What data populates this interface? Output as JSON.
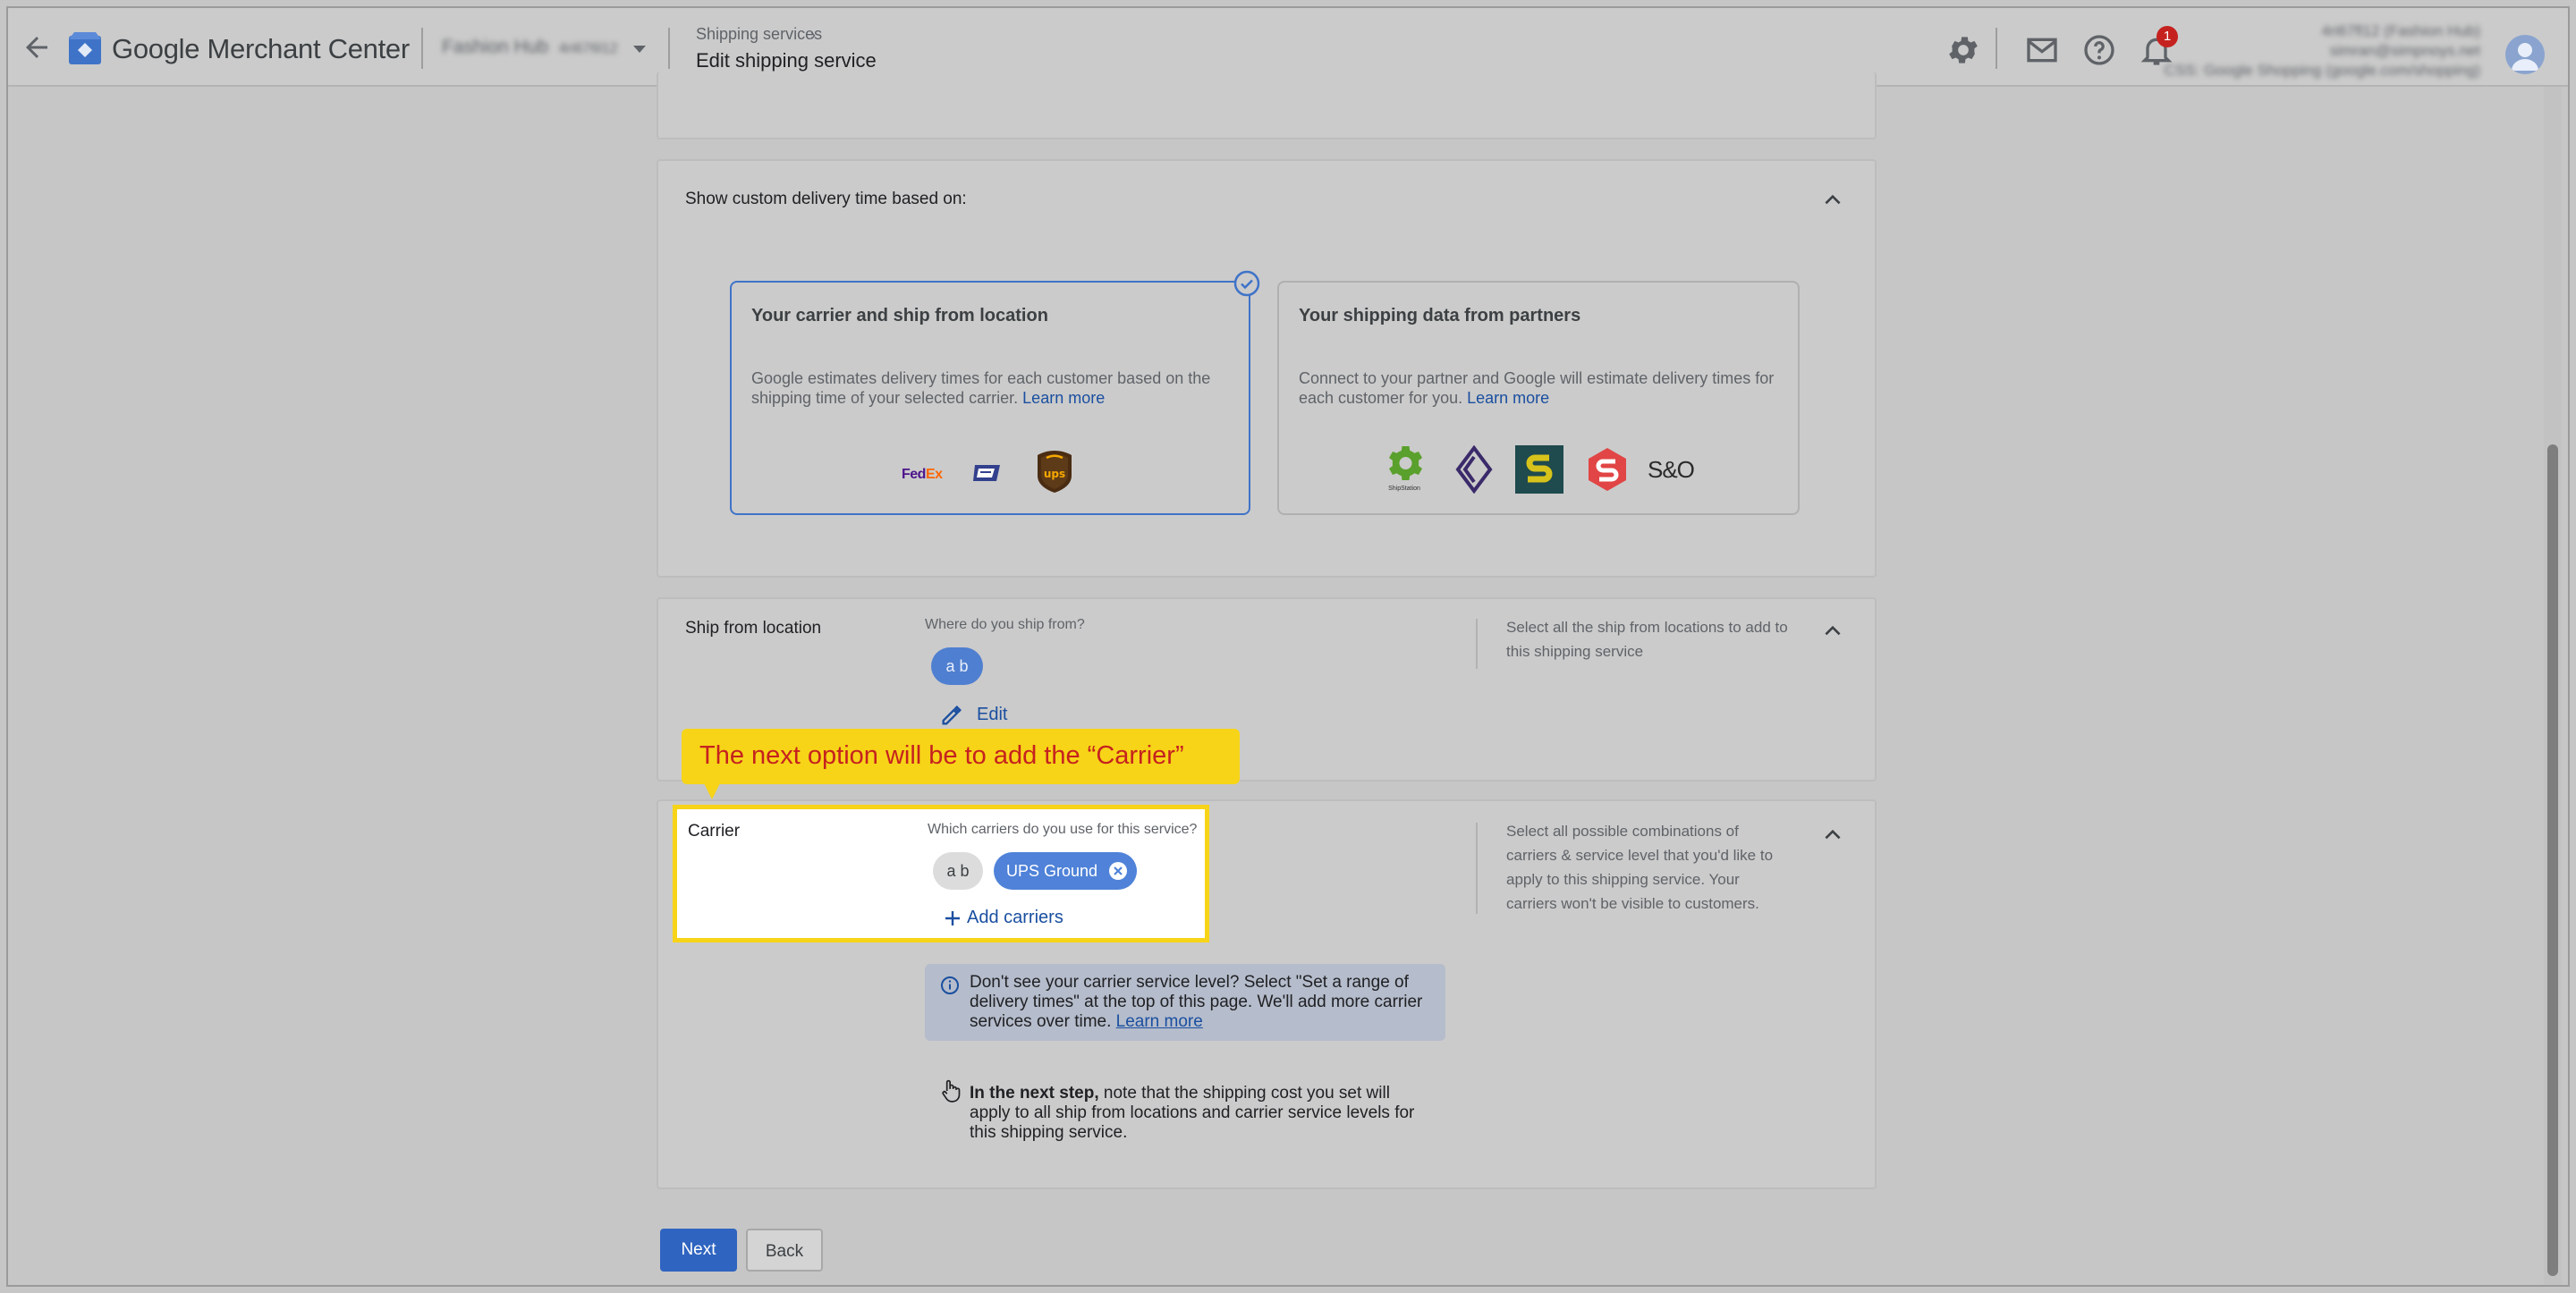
{
  "header": {
    "brand": "Google Merchant Center",
    "account_name": "Fashion Hub",
    "account_id": "4ri676l12",
    "breadcrumb": "Shipping services",
    "page_title": "Edit shipping service",
    "notification_count": "1",
    "user_line1": "4ri67fl12 (Fashion Hub)",
    "user_line2": "simran@simpnoys.net",
    "user_line3": "CSS: Google Shopping (google.com/shopping)"
  },
  "custom_delivery": {
    "title": "Show custom delivery time based on:",
    "option1": {
      "title": "Your carrier and ship from location",
      "desc": "Google estimates delivery times for each customer based on the shipping time of your selected carrier.",
      "link": "Learn more",
      "carriers": [
        "FedEx",
        "USPS",
        "UPS"
      ]
    },
    "option2": {
      "title": "Your shipping data from partners",
      "desc": "Connect to your partner and Google will estimate delivery times for each customer for you.",
      "link": "Learn more",
      "partners": [
        "ShipStation",
        "Partner 2",
        "Partner 3",
        "Partner 4",
        "S&O"
      ],
      "shipstation_label": "ShipStation",
      "so_label": "S&O"
    }
  },
  "ship_from": {
    "title": "Ship from location",
    "question": "Where do you ship from?",
    "chip": "a b",
    "edit": "Edit",
    "help": "Select all the ship from locations to add to this shipping service"
  },
  "carrier": {
    "title": "Carrier",
    "question": "Which carriers do you use for this service?",
    "chip_location": "a b",
    "chip_carrier": "UPS Ground",
    "add": "Add carriers",
    "help": "Select all possible combinations of carriers & service level that you'd like to apply to this shipping service. Your carriers won't be visible to customers.",
    "info": "Don't see your carrier service level? Select \"Set a range of delivery times\" at the top of this page. We'll add more carrier services over time.",
    "info_link": "Learn more",
    "next_step_bold": "In the next step,",
    "next_step": "note that the shipping cost you set will apply to all ship from locations and carrier service levels for this shipping service."
  },
  "callout": "The next option will be to add the “Carrier”",
  "buttons": {
    "next": "Next",
    "back": "Back"
  },
  "colors": {
    "accent": "#3f73c8",
    "callout": "#f7d417",
    "callout_text": "#c5221f"
  }
}
